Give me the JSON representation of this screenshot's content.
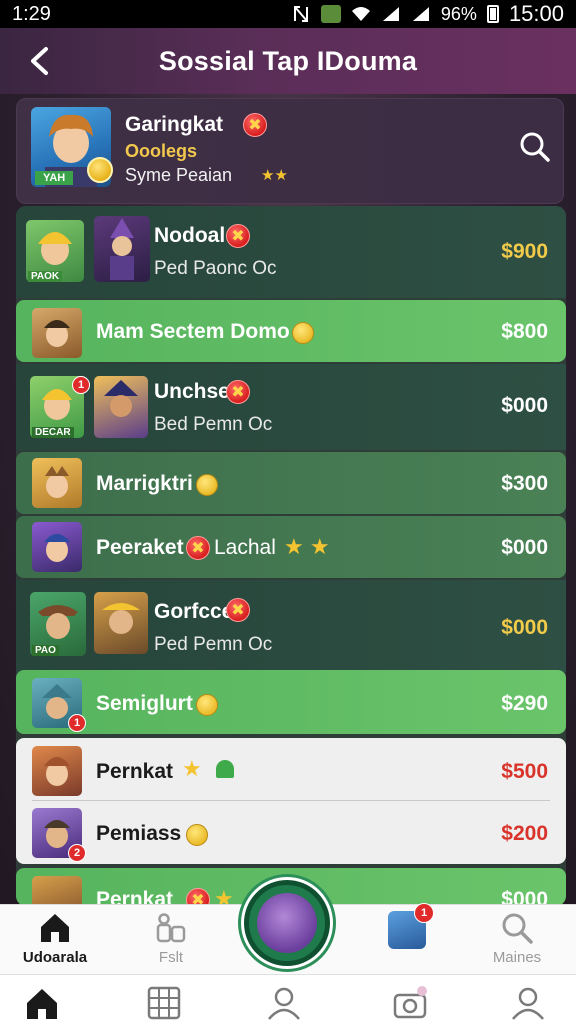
{
  "status_bar": {
    "time_left": "1:29",
    "battery": "96%",
    "time_right": "15:00"
  },
  "header": {
    "title": "Sossial Tap IDouma"
  },
  "profile": {
    "name": "Garingkat",
    "subtitle": "Ooolegs",
    "description": "Syme Peaian",
    "avatar_tag": "YAH"
  },
  "rows": [
    {
      "label": "Nodoal",
      "sublabel": "Ped Paonc Oc",
      "price": "$900",
      "avatar_tag": "PAOK"
    },
    {
      "label": "Mam Sectem Domo",
      "price": "$800"
    },
    {
      "label": "Unchse",
      "sublabel": "Bed Pemn Oc",
      "price": "$000",
      "avatar_tag": "DECAR",
      "notif": "1"
    },
    {
      "label": "Marrigktri",
      "price": "$300"
    },
    {
      "label": "Peeraket",
      "label2": "Lachal",
      "price": "$000"
    },
    {
      "label": "Gorfcce",
      "sublabel": "Ped Pemn Oc",
      "price": "$000",
      "avatar_tag": "PAO"
    },
    {
      "label": "Semiglurt",
      "price": "$290",
      "notif": "1"
    },
    {
      "label": "Pernkat",
      "price": "$500"
    },
    {
      "label": "Pemiass",
      "price": "$200",
      "notif": "2"
    },
    {
      "label": "Pernkat",
      "price": "$000"
    }
  ],
  "bottom_nav": {
    "items": [
      {
        "label": "Udoarala"
      },
      {
        "label": "Fslt"
      },
      {
        "label": "Maines"
      }
    ],
    "notif_count": "1"
  },
  "colors": {
    "header_gradient": [
      "#3a2640",
      "#6a3060"
    ],
    "row_dark": "#2e4f43",
    "row_bright": "#6ac46a",
    "price_gold": "#f2cb4a",
    "price_red": "#d9342b"
  }
}
